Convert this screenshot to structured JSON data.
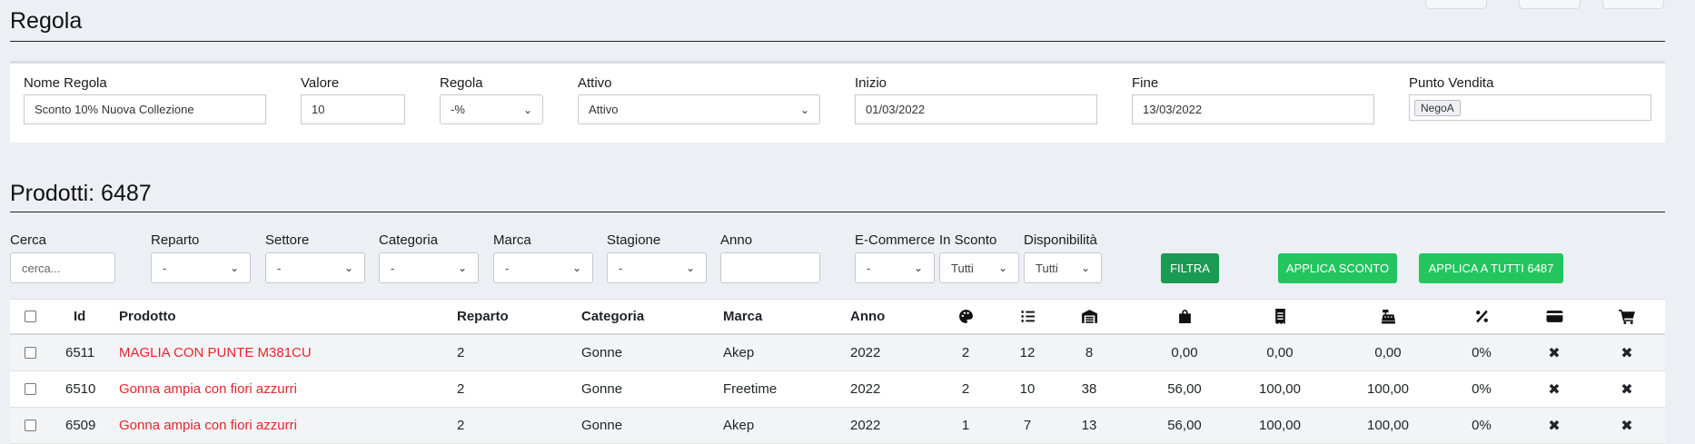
{
  "rule": {
    "title": "Regola",
    "fields": {
      "nome": {
        "label": "Nome Regola",
        "value": "Sconto 10% Nuova Collezione"
      },
      "valore": {
        "label": "Valore",
        "value": "10"
      },
      "regola": {
        "label": "Regola",
        "value": "-%"
      },
      "attivo": {
        "label": "Attivo",
        "value": "Attivo"
      },
      "inizio": {
        "label": "Inizio",
        "value": "01/03/2022"
      },
      "fine": {
        "label": "Fine",
        "value": "13/03/2022"
      },
      "punto": {
        "label": "Punto Vendita",
        "value": "NegoA"
      }
    }
  },
  "products": {
    "title": "Prodotti: 6487",
    "filters": {
      "cerca": {
        "label": "Cerca",
        "placeholder": "cerca..."
      },
      "reparto": {
        "label": "Reparto",
        "value": "-"
      },
      "settore": {
        "label": "Settore",
        "value": "-"
      },
      "categoria": {
        "label": "Categoria",
        "value": "-"
      },
      "marca": {
        "label": "Marca",
        "value": "-"
      },
      "stagione": {
        "label": "Stagione",
        "value": "-"
      },
      "anno": {
        "label": "Anno",
        "value": ""
      },
      "ecommerce": {
        "label": "E-Commerce",
        "value": "-"
      },
      "insconto": {
        "label": "In Sconto",
        "value": "Tutti"
      },
      "disponibilita": {
        "label": "Disponibilità",
        "value": "Tutti"
      }
    },
    "buttons": {
      "filtra": "FILTRA",
      "applica": "APPLICA SCONTO",
      "applica_tutti": "APPLICA A TUTTI 6487"
    },
    "columns": {
      "id": "Id",
      "prodotto": "Prodotto",
      "reparto": "Reparto",
      "categoria": "Categoria",
      "marca": "Marca",
      "anno": "Anno"
    },
    "icons": [
      "palette-icon",
      "list-ol-icon",
      "warehouse-icon",
      "shopping-bag-icon",
      "receipt-icon",
      "cash-register-icon",
      "percent-icon",
      "credit-card-icon",
      "cart-icon"
    ],
    "rows": [
      {
        "id": "6511",
        "prodotto": "MAGLIA CON PUNTE M381CU",
        "reparto": "2",
        "categoria": "Gonne",
        "marca": "Akep",
        "anno": "2022",
        "v1": "2",
        "v2": "12",
        "v3": "8",
        "p1": "0,00",
        "p2": "0,00",
        "p3": "0,00",
        "sconto": "0%",
        "x1": "✖",
        "x2": "✖"
      },
      {
        "id": "6510",
        "prodotto": "Gonna ampia con fiori azzurri",
        "reparto": "2",
        "categoria": "Gonne",
        "marca": "Freetime",
        "anno": "2022",
        "v1": "2",
        "v2": "10",
        "v3": "38",
        "p1": "56,00",
        "p2": "100,00",
        "p3": "100,00",
        "sconto": "0%",
        "x1": "✖",
        "x2": "✖"
      },
      {
        "id": "6509",
        "prodotto": "Gonna ampia con fiori azzurri",
        "reparto": "2",
        "categoria": "Gonne",
        "marca": "Akep",
        "anno": "2022",
        "v1": "1",
        "v2": "7",
        "v3": "13",
        "p1": "56,00",
        "p2": "100,00",
        "p3": "100,00",
        "sconto": "0%",
        "x1": "✖",
        "x2": "✖"
      }
    ]
  },
  "colors": {
    "accent_red": "#e3262e",
    "filter_button": "#1a9a52",
    "apply_button": "#22c55e"
  }
}
